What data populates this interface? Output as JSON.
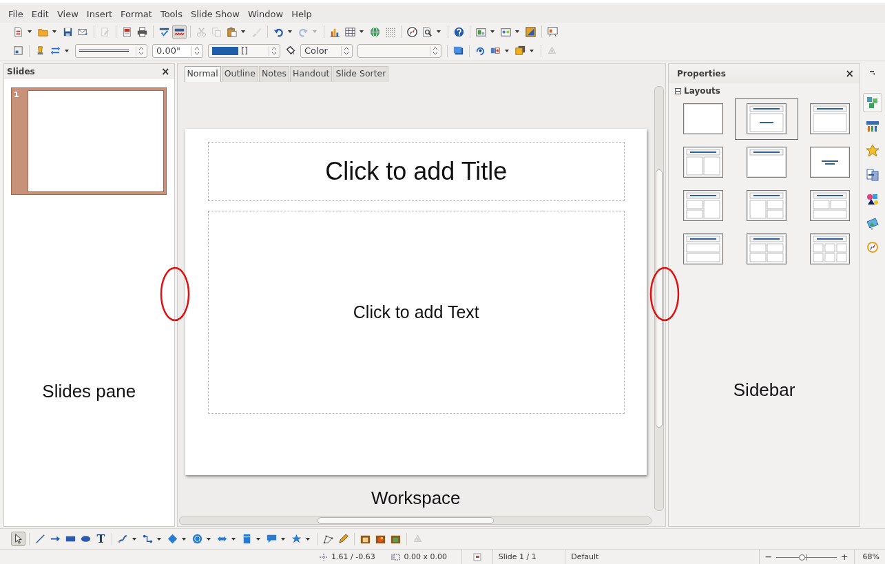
{
  "menu": [
    "File",
    "Edit",
    "View",
    "Insert",
    "Format",
    "Tools",
    "Slide Show",
    "Window",
    "Help"
  ],
  "standard_toolbar": [
    {
      "kind": "new",
      "disabled": false,
      "on": false
    },
    {
      "kind": "open",
      "disabled": false,
      "on": false
    },
    {
      "kind": "save",
      "disabled": false,
      "on": false
    },
    {
      "kind": "email",
      "disabled": false,
      "on": false
    },
    {
      "kind": "separator"
    },
    {
      "kind": "edit",
      "disabled": true,
      "on": false
    },
    {
      "kind": "separator"
    },
    {
      "kind": "pdf",
      "disabled": false,
      "on": false
    },
    {
      "kind": "print",
      "disabled": false,
      "on": false
    },
    {
      "kind": "separator"
    },
    {
      "kind": "spell",
      "disabled": false,
      "on": false
    },
    {
      "kind": "autospell",
      "disabled": false,
      "on": true
    },
    {
      "kind": "separator"
    },
    {
      "kind": "cut",
      "disabled": true,
      "on": false
    },
    {
      "kind": "copy",
      "disabled": true,
      "on": false
    },
    {
      "kind": "paste",
      "disabled": false,
      "on": false
    },
    {
      "kind": "clone",
      "disabled": true,
      "on": false
    },
    {
      "kind": "separator"
    },
    {
      "kind": "undo",
      "disabled": false,
      "on": false
    },
    {
      "kind": "redo",
      "disabled": true,
      "on": false
    },
    {
      "kind": "separator"
    },
    {
      "kind": "chart",
      "disabled": false,
      "on": false
    },
    {
      "kind": "table",
      "disabled": false,
      "on": false
    },
    {
      "kind": "media",
      "disabled": false,
      "on": false
    },
    {
      "kind": "grid",
      "disabled": false,
      "on": false
    },
    {
      "kind": "separator"
    },
    {
      "kind": "navigator",
      "disabled": false,
      "on": false
    },
    {
      "kind": "zoom",
      "disabled": false,
      "on": false
    },
    {
      "kind": "separator"
    },
    {
      "kind": "help",
      "disabled": false,
      "on": false
    },
    {
      "kind": "separator"
    },
    {
      "kind": "layout",
      "disabled": false,
      "on": false
    },
    {
      "kind": "display",
      "disabled": false,
      "on": false
    },
    {
      "kind": "master",
      "disabled": false,
      "on": false
    },
    {
      "kind": "separator"
    },
    {
      "kind": "slideshow",
      "disabled": false,
      "on": false
    }
  ],
  "line_toolbar": [
    {
      "kind": "design",
      "disabled": false,
      "on": false
    },
    {
      "kind": "separator"
    },
    {
      "kind": "linestyle",
      "disabled": false,
      "on": false
    },
    {
      "kind": "arrows",
      "disabled": false,
      "on": false
    },
    {
      "kind": "line_style_box"
    },
    {
      "kind": "width_field",
      "value": "0.00\""
    },
    {
      "kind": "color_box",
      "value": "[]",
      "color": "#1f5fa8"
    },
    {
      "kind": "area",
      "disabled": false,
      "on": false
    },
    {
      "kind": "area_type_box",
      "value": "Color"
    },
    {
      "kind": "fill_box"
    },
    {
      "kind": "separator"
    },
    {
      "kind": "shadow",
      "disabled": false,
      "on": false
    },
    {
      "kind": "separator"
    },
    {
      "kind": "rotate",
      "disabled": false,
      "on": false
    },
    {
      "kind": "align",
      "disabled": false,
      "on": false
    },
    {
      "kind": "arrange",
      "disabled": false,
      "on": false
    },
    {
      "kind": "separator"
    },
    {
      "kind": "extrusion",
      "disabled": true,
      "on": false
    }
  ],
  "slides_pane": {
    "title": "Slides",
    "close": "×",
    "slides": [
      {
        "number": "1",
        "selected": true
      }
    ],
    "annotation": "Slides pane"
  },
  "workspace": {
    "tabs": [
      {
        "label": "Normal",
        "selected": true
      },
      {
        "label": "Outline",
        "selected": false
      },
      {
        "label": "Notes",
        "selected": false
      },
      {
        "label": "Handout",
        "selected": false
      },
      {
        "label": "Slide Sorter",
        "selected": false
      }
    ],
    "slide": {
      "title_placeholder": "Click to add Title",
      "text_placeholder": "Click to add Text"
    },
    "annotation": "Workspace"
  },
  "sidebar": {
    "title": "Properties",
    "close": "×",
    "section": {
      "title": "Layouts",
      "expanded": true
    },
    "layouts": [
      {
        "kind": "blank",
        "selected": false
      },
      {
        "kind": "title_slide",
        "selected": true
      },
      {
        "kind": "title_content",
        "selected": false
      },
      {
        "kind": "title_2content",
        "selected": false
      },
      {
        "kind": "title_only",
        "selected": false
      },
      {
        "kind": "centered",
        "selected": false
      },
      {
        "kind": "left_split",
        "selected": false
      },
      {
        "kind": "right_split",
        "selected": false
      },
      {
        "kind": "top_split",
        "selected": false
      },
      {
        "kind": "stacked",
        "selected": false
      },
      {
        "kind": "four",
        "selected": false
      },
      {
        "kind": "six",
        "selected": false
      }
    ],
    "deck": [
      {
        "kind": "properties",
        "selected": true
      },
      {
        "kind": "styles",
        "selected": false
      },
      {
        "kind": "gallery",
        "selected": false
      },
      {
        "kind": "transition",
        "selected": false
      },
      {
        "kind": "animation",
        "selected": false
      },
      {
        "kind": "pictures",
        "selected": false
      },
      {
        "kind": "navigator",
        "selected": false
      }
    ],
    "annotation": "Sidebar"
  },
  "drawing_toolbar": [
    {
      "kind": "select",
      "disabled": false,
      "on": true
    },
    {
      "kind": "separator"
    },
    {
      "kind": "line",
      "disabled": false,
      "on": false
    },
    {
      "kind": "arrow",
      "disabled": false,
      "on": false
    },
    {
      "kind": "rect",
      "disabled": false,
      "on": false
    },
    {
      "kind": "ellipse",
      "disabled": false,
      "on": false
    },
    {
      "kind": "text",
      "glyph": "T",
      "disabled": false,
      "on": false
    },
    {
      "kind": "separator"
    },
    {
      "kind": "curve",
      "disabled": false,
      "on": false
    },
    {
      "kind": "connector",
      "disabled": false,
      "on": false
    },
    {
      "kind": "diamond",
      "disabled": false,
      "on": false
    },
    {
      "kind": "symbol",
      "disabled": false,
      "on": false
    },
    {
      "kind": "blockarrow",
      "disabled": false,
      "on": false
    },
    {
      "kind": "flowchart",
      "disabled": false,
      "on": false
    },
    {
      "kind": "callout",
      "disabled": false,
      "on": false
    },
    {
      "kind": "star",
      "disabled": false,
      "on": false
    },
    {
      "kind": "separator"
    },
    {
      "kind": "points",
      "disabled": false,
      "on": false
    },
    {
      "kind": "pen",
      "disabled": false,
      "on": false
    },
    {
      "kind": "separator"
    },
    {
      "kind": "frame",
      "disabled": false,
      "on": false
    },
    {
      "kind": "gallery2",
      "disabled": false,
      "on": false
    },
    {
      "kind": "photo",
      "disabled": false,
      "on": false
    },
    {
      "kind": "separator"
    },
    {
      "kind": "extrusion",
      "disabled": true,
      "on": false
    }
  ],
  "status_bar": {
    "position": "1.61 / -0.63",
    "size": "0.00 x 0.00",
    "slide": "Slide 1 / 1",
    "master": "Default",
    "zoom_out": "−",
    "zoom_in": "+",
    "zoom": {
      "level": 0.42
    },
    "zoom_text": "68%"
  }
}
